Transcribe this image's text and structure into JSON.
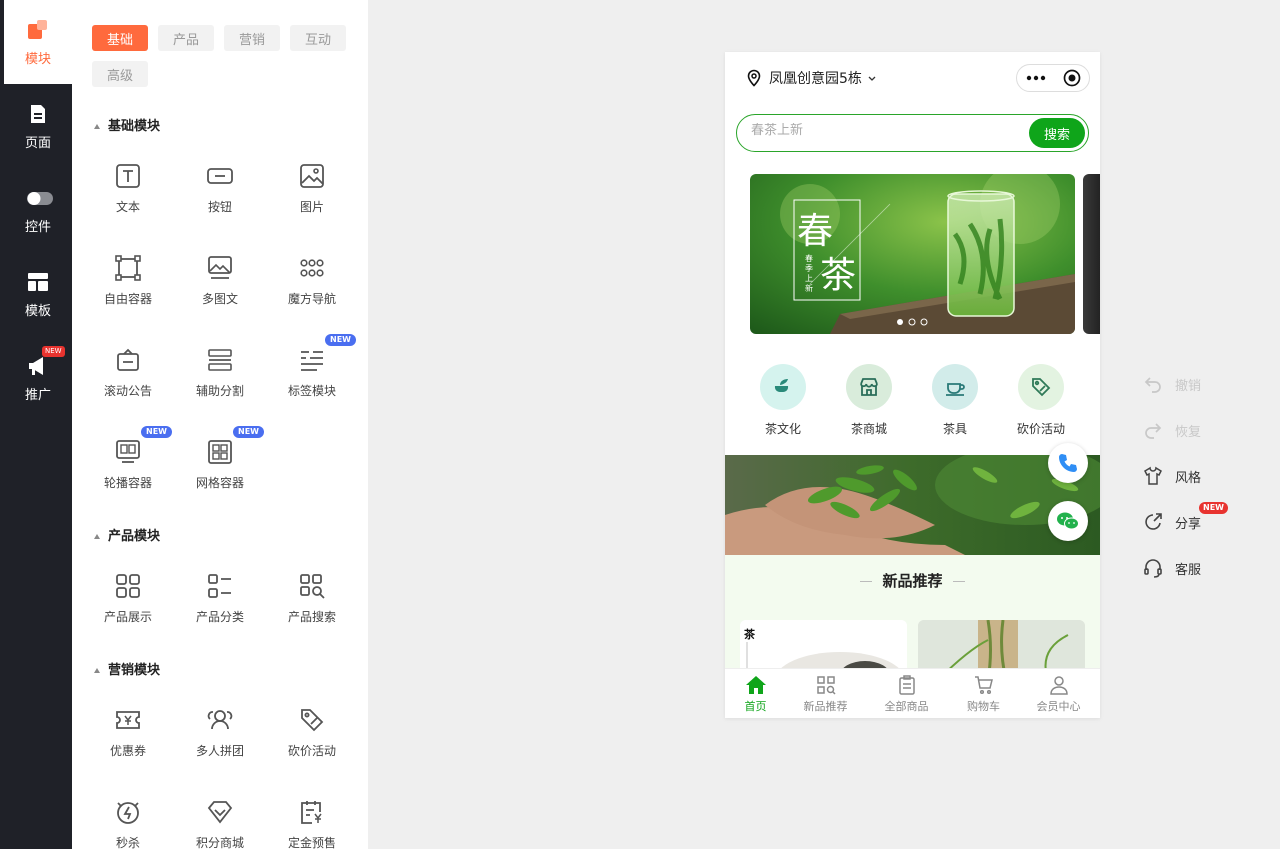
{
  "leftnav": {
    "items": [
      {
        "label": "模块",
        "icon": "module-icon"
      },
      {
        "label": "页面",
        "icon": "page-icon"
      },
      {
        "label": "控件",
        "icon": "toggle-icon"
      },
      {
        "label": "模板",
        "icon": "template-icon"
      },
      {
        "label": "推广",
        "icon": "megaphone-icon",
        "badge": "NEW"
      }
    ]
  },
  "panel": {
    "tabs": [
      "基础",
      "产品",
      "营销",
      "互动",
      "高级"
    ],
    "sections": [
      {
        "title": "基础模块",
        "items": [
          {
            "label": "文本"
          },
          {
            "label": "按钮"
          },
          {
            "label": "图片"
          },
          {
            "label": "自由容器"
          },
          {
            "label": "多图文"
          },
          {
            "label": "魔方导航"
          },
          {
            "label": "滚动公告"
          },
          {
            "label": "辅助分割"
          },
          {
            "label": "标签模块",
            "badge": "NEW"
          },
          {
            "label": "轮播容器",
            "badge": "NEW"
          },
          {
            "label": "网格容器",
            "badge": "NEW"
          }
        ]
      },
      {
        "title": "产品模块",
        "items": [
          {
            "label": "产品展示"
          },
          {
            "label": "产品分类"
          },
          {
            "label": "产品搜索"
          }
        ]
      },
      {
        "title": "营销模块",
        "items": [
          {
            "label": "优惠券"
          },
          {
            "label": "多人拼团"
          },
          {
            "label": "砍价活动"
          },
          {
            "label": "秒杀"
          },
          {
            "label": "积分商城"
          },
          {
            "label": "定金预售"
          }
        ]
      }
    ]
  },
  "phone": {
    "location": "凤凰创意园5栋",
    "search": {
      "placeholder": "春茶上新",
      "button": "搜索"
    },
    "banner": {
      "big_char_1": "春",
      "big_char_2": "茶",
      "small_text": "春季上新"
    },
    "quick_nav": [
      {
        "label": "茶文化",
        "color": "#d5f3ee"
      },
      {
        "label": "茶商城",
        "color": "#d9ecdb"
      },
      {
        "label": "茶具",
        "color": "#d2ecea"
      },
      {
        "label": "砍价活动",
        "color": "#e3f3e1"
      }
    ],
    "new_section_title": "新品推荐",
    "card_text": "茶",
    "tabbar": [
      "首页",
      "新品推荐",
      "全部商品",
      "购物车",
      "会员中心"
    ],
    "accent": "#0fa51a"
  },
  "right_tools": [
    {
      "label": "撤销",
      "enabled": false
    },
    {
      "label": "恢复",
      "enabled": false
    },
    {
      "label": "风格",
      "enabled": true
    },
    {
      "label": "分享",
      "enabled": true,
      "badge": "NEW"
    },
    {
      "label": "客服",
      "enabled": true
    }
  ]
}
